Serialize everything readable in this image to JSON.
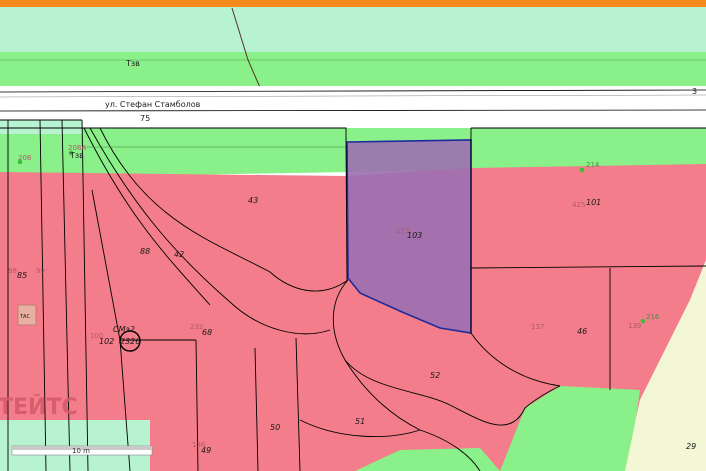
{
  "top_bar_color": "#f28a1c",
  "colors": {
    "residential": "#f37d8a",
    "greenery": "#8af08a",
    "light_green": "#b7f3d0",
    "selected": "#9b6fb0",
    "selected_outline": "#1f2a9c",
    "road": "#ffffff",
    "boundary": "#000000"
  },
  "street": {
    "name": "ул. Стефан Стамболов",
    "number_left": "75",
    "number_right": "3"
  },
  "zone_labels": {
    "upper": "Тзв",
    "left": "Тзв"
  },
  "plots": {
    "p43": "43",
    "p42": "42",
    "p88": "88",
    "p103": "103",
    "p101": "101",
    "p46": "46",
    "p52": "52",
    "p51": "51",
    "p50": "50",
    "p49": "49",
    "p68": "68",
    "p102": "102",
    "p85": "85",
    "p29": "29"
  },
  "cadastral_numbers": {
    "c208": "208",
    "c208a": "208А",
    "c214": "214",
    "c425": "425",
    "c253": "253",
    "c137": "137",
    "c139": "139",
    "c216": "216",
    "c232": "232",
    "c100": "100",
    "c98": "98",
    "c99": "99",
    "c136": "136"
  },
  "marker": {
    "code": "СМэ2",
    "number": "2326"
  },
  "small_box_label": "ТАС",
  "watermark": "ТЕЙТС",
  "scale": {
    "label": "10 m"
  }
}
